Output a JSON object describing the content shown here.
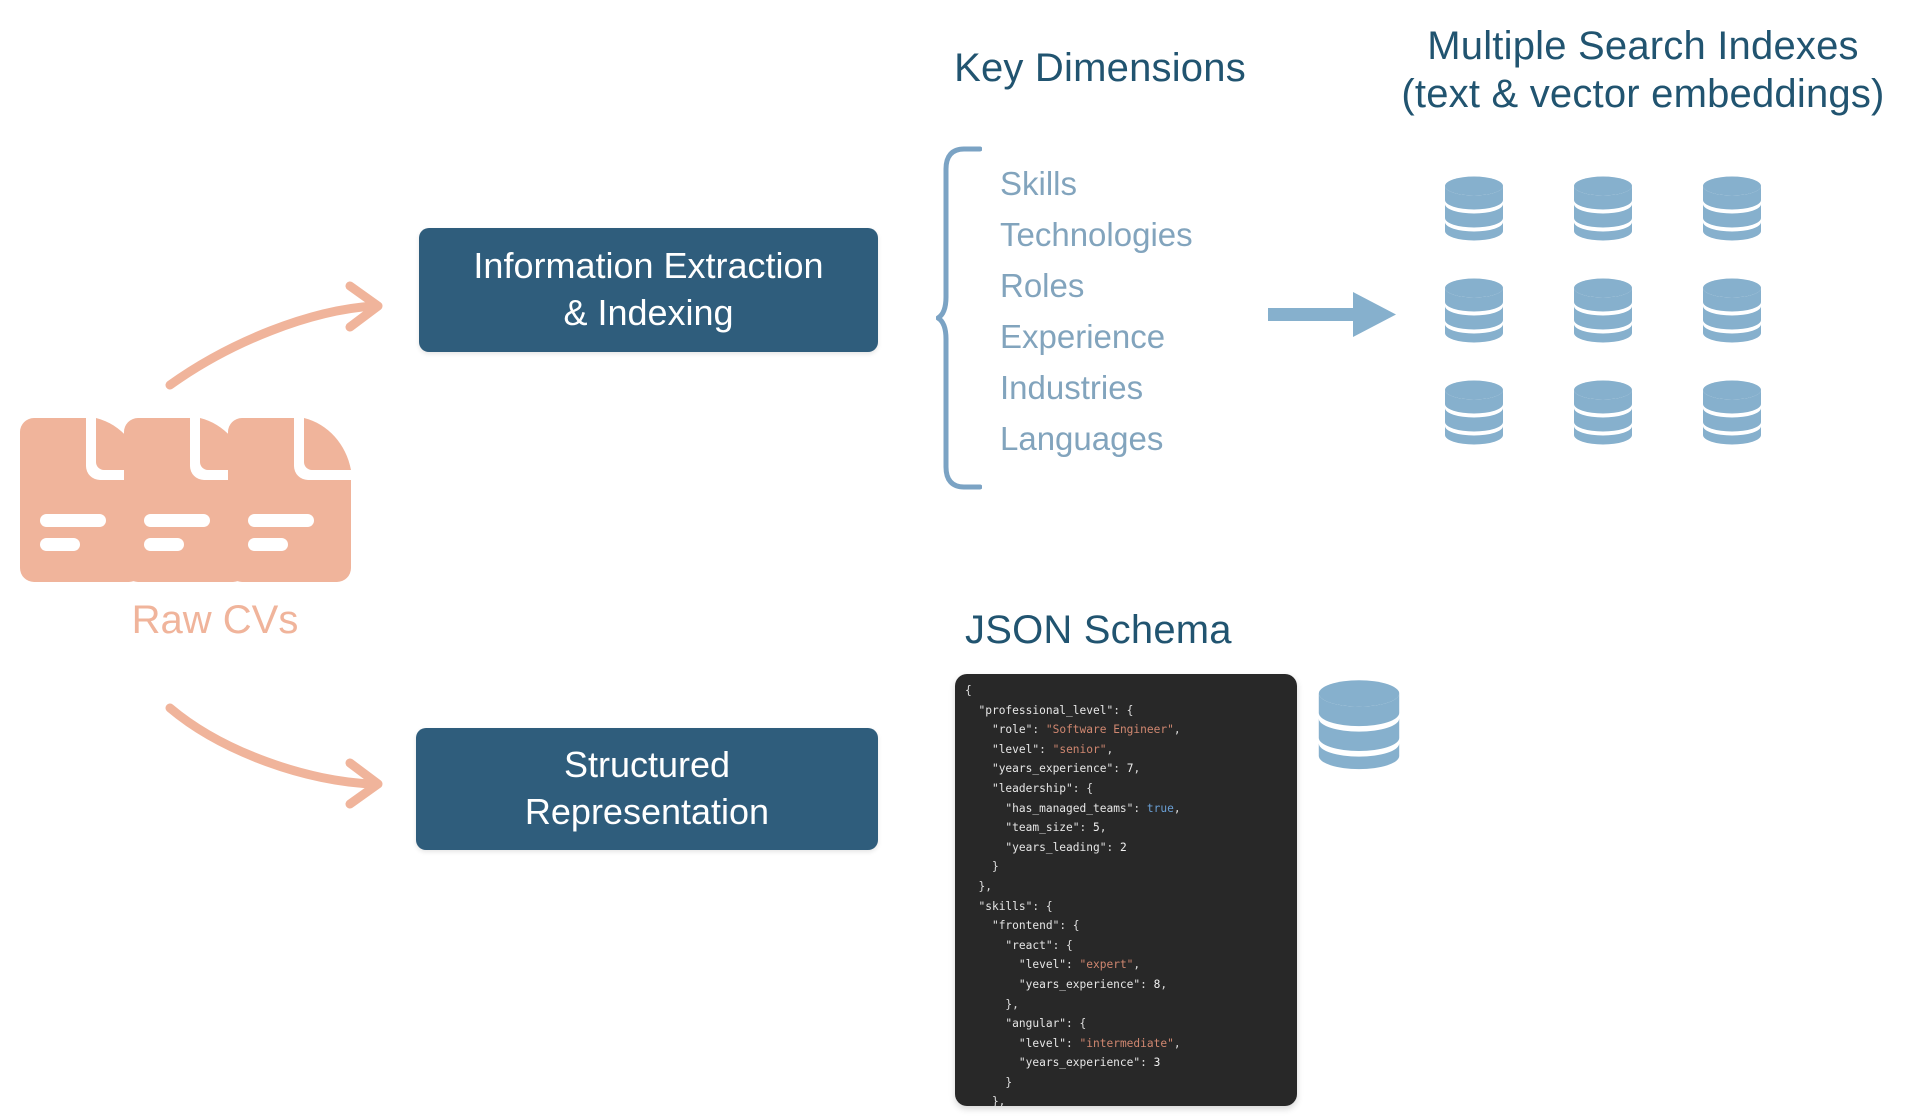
{
  "colors": {
    "dark_blue": "#215470",
    "box_fill": "#2f5d7c",
    "salmon": "#f0b49b",
    "steel_blue": "#86b0cd",
    "muted_blue": "#82a4bd",
    "brace_blue": "#7ba3c4",
    "code_bg": "#282828",
    "code_string": "#d08770",
    "code_bool": "#6a9fd4"
  },
  "raw_cvs": {
    "label": "Raw CVs",
    "document_count": 3
  },
  "boxes": {
    "extraction": "Information Extraction\n& Indexing",
    "extraction_line1": "Information Extraction",
    "extraction_line2": "& Indexing",
    "structured_line1": "Structured",
    "structured_line2": "Representation"
  },
  "key_dimensions": {
    "title": "Key Dimensions",
    "items": [
      {
        "label": "Skills"
      },
      {
        "label": "Technologies"
      },
      {
        "label": "Roles"
      },
      {
        "label": "Experience"
      },
      {
        "label": "Industries"
      },
      {
        "label": "Languages"
      }
    ]
  },
  "search_indexes": {
    "title_line1": "Multiple Search Indexes",
    "title_line2": "(text & vector embeddings)",
    "database_count": 9,
    "grid_rows": 3,
    "grid_cols": 3
  },
  "json_schema": {
    "title": "JSON Schema",
    "database_count": 1,
    "code_lines": [
      [
        {
          "t": "{",
          "c": "punct"
        }
      ],
      [
        {
          "t": "  ",
          "c": "punct"
        },
        {
          "t": "\"professional_level\"",
          "c": "key"
        },
        {
          "t": ": {",
          "c": "punct"
        }
      ],
      [
        {
          "t": "    ",
          "c": "punct"
        },
        {
          "t": "\"role\"",
          "c": "key"
        },
        {
          "t": ": ",
          "c": "punct"
        },
        {
          "t": "\"Software Engineer\"",
          "c": "str"
        },
        {
          "t": ",",
          "c": "punct"
        }
      ],
      [
        {
          "t": "    ",
          "c": "punct"
        },
        {
          "t": "\"level\"",
          "c": "key"
        },
        {
          "t": ": ",
          "c": "punct"
        },
        {
          "t": "\"senior\"",
          "c": "str"
        },
        {
          "t": ",",
          "c": "punct"
        }
      ],
      [
        {
          "t": "    ",
          "c": "punct"
        },
        {
          "t": "\"years_experience\"",
          "c": "key"
        },
        {
          "t": ": ",
          "c": "punct"
        },
        {
          "t": "7",
          "c": "num"
        },
        {
          "t": ",",
          "c": "punct"
        }
      ],
      [
        {
          "t": "    ",
          "c": "punct"
        },
        {
          "t": "\"leadership\"",
          "c": "key"
        },
        {
          "t": ": {",
          "c": "punct"
        }
      ],
      [
        {
          "t": "      ",
          "c": "punct"
        },
        {
          "t": "\"has_managed_teams\"",
          "c": "key"
        },
        {
          "t": ": ",
          "c": "punct"
        },
        {
          "t": "true",
          "c": "bool"
        },
        {
          "t": ",",
          "c": "punct"
        }
      ],
      [
        {
          "t": "      ",
          "c": "punct"
        },
        {
          "t": "\"team_size\"",
          "c": "key"
        },
        {
          "t": ": ",
          "c": "punct"
        },
        {
          "t": "5",
          "c": "num"
        },
        {
          "t": ",",
          "c": "punct"
        }
      ],
      [
        {
          "t": "      ",
          "c": "punct"
        },
        {
          "t": "\"years_leading\"",
          "c": "key"
        },
        {
          "t": ": ",
          "c": "punct"
        },
        {
          "t": "2",
          "c": "num"
        }
      ],
      [
        {
          "t": "    }",
          "c": "punct"
        }
      ],
      [
        {
          "t": "  },",
          "c": "punct"
        }
      ],
      [
        {
          "t": "  ",
          "c": "punct"
        },
        {
          "t": "\"skills\"",
          "c": "key"
        },
        {
          "t": ": {",
          "c": "punct"
        }
      ],
      [
        {
          "t": "    ",
          "c": "punct"
        },
        {
          "t": "\"frontend\"",
          "c": "key"
        },
        {
          "t": ": {",
          "c": "punct"
        }
      ],
      [
        {
          "t": "      ",
          "c": "punct"
        },
        {
          "t": "\"react\"",
          "c": "key"
        },
        {
          "t": ": {",
          "c": "punct"
        }
      ],
      [
        {
          "t": "        ",
          "c": "punct"
        },
        {
          "t": "\"level\"",
          "c": "key"
        },
        {
          "t": ": ",
          "c": "punct"
        },
        {
          "t": "\"expert\"",
          "c": "str"
        },
        {
          "t": ",",
          "c": "punct"
        }
      ],
      [
        {
          "t": "        ",
          "c": "punct"
        },
        {
          "t": "\"years_experience\"",
          "c": "key"
        },
        {
          "t": ": ",
          "c": "punct"
        },
        {
          "t": "8",
          "c": "num"
        },
        {
          "t": ",",
          "c": "punct"
        }
      ],
      [
        {
          "t": "      },",
          "c": "punct"
        }
      ],
      [
        {
          "t": "      ",
          "c": "punct"
        },
        {
          "t": "\"angular\"",
          "c": "key"
        },
        {
          "t": ": {",
          "c": "punct"
        }
      ],
      [
        {
          "t": "        ",
          "c": "punct"
        },
        {
          "t": "\"level\"",
          "c": "key"
        },
        {
          "t": ": ",
          "c": "punct"
        },
        {
          "t": "\"intermediate\"",
          "c": "str"
        },
        {
          "t": ",",
          "c": "punct"
        }
      ],
      [
        {
          "t": "        ",
          "c": "punct"
        },
        {
          "t": "\"years_experience\"",
          "c": "key"
        },
        {
          "t": ": ",
          "c": "punct"
        },
        {
          "t": "3",
          "c": "num"
        }
      ],
      [
        {
          "t": "      }",
          "c": "punct"
        }
      ],
      [
        {
          "t": "    },",
          "c": "punct"
        }
      ]
    ]
  },
  "arrows": {
    "cv_to_extraction": "curved-arrow-up",
    "cv_to_structured": "curved-arrow-down",
    "dimensions_to_indexes": "straight-arrow-right"
  }
}
